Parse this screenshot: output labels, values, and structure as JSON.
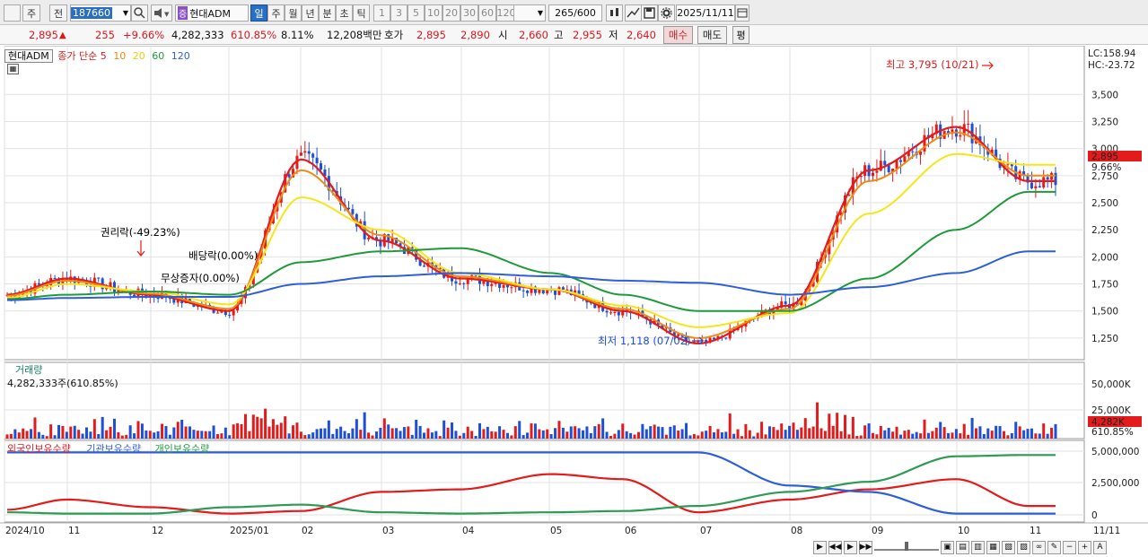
{
  "toolbar": {
    "market_label": "주",
    "prev_label": "전",
    "code": "187660",
    "stock_badge": "증",
    "stock_name": "현대ADM",
    "periods": [
      "일",
      "주",
      "월",
      "년",
      "분",
      "초",
      "틱"
    ],
    "active_period": "일",
    "intervals": [
      "1",
      "3",
      "5",
      "10",
      "20",
      "30",
      "60",
      "120"
    ],
    "count": "265",
    "count_total": "/600",
    "date": "2025/11/11"
  },
  "quote": {
    "price": "2,895",
    "arrow": "▲",
    "change": "255",
    "change_pct": "+9.66%",
    "volume": "4,282,333",
    "volume_ratio": "610.85%",
    "turnover": "8.11%",
    "amount": "12,208백만",
    "bid_label": "호가",
    "ask": "2,895",
    "bid": "2,890",
    "open_label": "시",
    "open": "2,660",
    "high_label": "고",
    "high": "2,955",
    "low_label": "저",
    "low": "2,640",
    "buy_label": "매수",
    "sell_label": "매도",
    "eval_label": "평"
  },
  "price_panel": {
    "name": "현대ADM",
    "ma_title": "종가 단순",
    "ma_periods": [
      "5",
      "10",
      "20",
      "60",
      "120"
    ],
    "ma_colors": [
      "#e31b1b",
      "#f08a12",
      "#f5e61a",
      "#1f9a3a",
      "#2e5fd8"
    ],
    "lc": "LC:158.94",
    "hc": "HC:-23.72",
    "y_ticks": [
      "3,500",
      "3,250",
      "3,000",
      "2,750",
      "2,500",
      "2,250",
      "2,000",
      "1,750",
      "1,500",
      "1,250"
    ],
    "price_tag": "2,895",
    "pct_tag": "9.66%",
    "high_annot": "최고 3,795 (10/21)",
    "low_annot": "최저 1,118 (07/02)",
    "event_rights": "권리락(-49.23%)",
    "event_dividend": "배당락(0.00%)",
    "event_bonus": "무상증자(0.00%)"
  },
  "volume_panel": {
    "title": "거래량",
    "value": "4,282,333주(610.85%)",
    "y_ticks": [
      "50,000K",
      "25,000K"
    ],
    "tag_vol": "4,282K",
    "tag_pct": "610.85%"
  },
  "holder_panel": {
    "foreign_label": "외국인보유수량",
    "inst_label": "기관보유수량",
    "indiv_label": "개인보유수량",
    "y_ticks": [
      "5,000,000",
      "2,500,000",
      "0"
    ]
  },
  "x_axis": [
    "2024/10",
    "11",
    "12",
    "2025/01",
    "02",
    "03",
    "04",
    "05",
    "06",
    "07",
    "08",
    "09",
    "10",
    "11"
  ],
  "x_right_label": "11/11",
  "chart_data": {
    "type": "line",
    "title": "현대ADM",
    "x": [
      "2024/10",
      "11",
      "12",
      "2025/01",
      "02",
      "03",
      "04",
      "05",
      "06",
      "07",
      "08",
      "09",
      "10",
      "11"
    ],
    "series": [
      {
        "name": "종가 단순 5",
        "values": [
          1650,
          1800,
          1650,
          1500,
          2900,
          2150,
          1800,
          1700,
          1500,
          1200,
          1550,
          2800,
          3200,
          2700
        ]
      },
      {
        "name": "10",
        "values": [
          1640,
          1780,
          1660,
          1520,
          2800,
          2200,
          1820,
          1700,
          1520,
          1250,
          1520,
          2700,
          3150,
          2750
        ]
      },
      {
        "name": "20",
        "values": [
          1620,
          1750,
          1680,
          1560,
          2550,
          2250,
          1850,
          1700,
          1550,
          1350,
          1480,
          2400,
          2950,
          2850
        ]
      },
      {
        "name": "60",
        "values": [
          1610,
          1650,
          1680,
          1650,
          1950,
          2050,
          2080,
          1850,
          1650,
          1500,
          1500,
          1800,
          2250,
          2600
        ]
      },
      {
        "name": "120",
        "values": [
          1600,
          1620,
          1630,
          1630,
          1750,
          1820,
          1850,
          1820,
          1780,
          1760,
          1650,
          1720,
          1850,
          2050
        ]
      }
    ],
    "ylim": [
      1050,
      3950
    ]
  }
}
